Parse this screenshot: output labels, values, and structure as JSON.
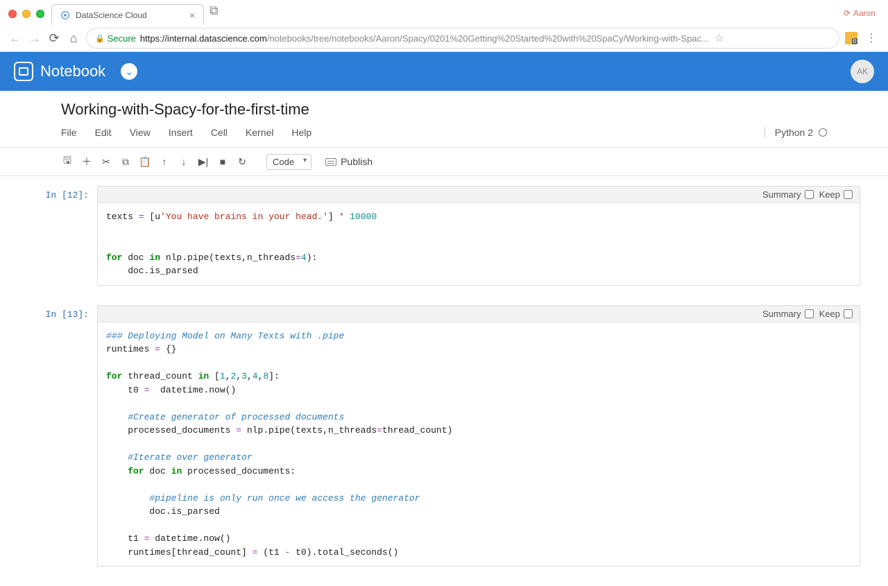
{
  "browser": {
    "tab_title": "DataScience Cloud",
    "profile": "Aaron",
    "secure_label": "Secure",
    "url_host": "https://internal.datascience.com",
    "url_path": "/notebooks/tree/notebooks/Aaron/Spacy/0201%20Getting%20Started%20with%20SpaCy/Working-with-Spac...",
    "ext_badge": "0"
  },
  "header": {
    "brand": "Notebook",
    "avatar_initials": "AK"
  },
  "notebook": {
    "title": "Working-with-Spacy-for-the-first-time",
    "menus": [
      "File",
      "Edit",
      "View",
      "Insert",
      "Cell",
      "Kernel",
      "Help"
    ],
    "kernel": "Python 2",
    "cell_type_label": "Code",
    "publish_label": "Publish",
    "cell_controls": {
      "summary": "Summary",
      "keep": "Keep"
    }
  },
  "cells": [
    {
      "prompt": "In [12]:",
      "code_tokens": [
        [
          "fn",
          "texts "
        ],
        [
          "op",
          "="
        ],
        [
          "fn",
          " ["
        ],
        [
          "fn",
          "u"
        ],
        [
          "str",
          "'You have brains in your head.'"
        ],
        [
          "fn",
          "] "
        ],
        [
          "op",
          "*"
        ],
        [
          "fn",
          " "
        ],
        [
          "num",
          "10000"
        ],
        [
          "nl",
          ""
        ],
        [
          "nl",
          ""
        ],
        [
          "nl",
          ""
        ],
        [
          "kw",
          "for"
        ],
        [
          "fn",
          " doc "
        ],
        [
          "kw",
          "in"
        ],
        [
          "fn",
          " nlp.pipe(texts,n_threads"
        ],
        [
          "op",
          "="
        ],
        [
          "num",
          "4"
        ],
        [
          "fn",
          "):"
        ],
        [
          "nl",
          ""
        ],
        [
          "fn",
          "    doc.is_parsed"
        ]
      ]
    },
    {
      "prompt": "In [13]:",
      "code_tokens": [
        [
          "cmt",
          "### Deploying Model on Many Texts with .pipe"
        ],
        [
          "nl",
          ""
        ],
        [
          "fn",
          "runtimes "
        ],
        [
          "op",
          "="
        ],
        [
          "fn",
          " {}"
        ],
        [
          "nl",
          ""
        ],
        [
          "nl",
          ""
        ],
        [
          "kw",
          "for"
        ],
        [
          "fn",
          " thread_count "
        ],
        [
          "kw",
          "in"
        ],
        [
          "fn",
          " ["
        ],
        [
          "num",
          "1"
        ],
        [
          "fn",
          ","
        ],
        [
          "num",
          "2"
        ],
        [
          "fn",
          ","
        ],
        [
          "num",
          "3"
        ],
        [
          "fn",
          ","
        ],
        [
          "num",
          "4"
        ],
        [
          "fn",
          ","
        ],
        [
          "num",
          "8"
        ],
        [
          "fn",
          "]:"
        ],
        [
          "nl",
          ""
        ],
        [
          "fn",
          "    t0 "
        ],
        [
          "op",
          "="
        ],
        [
          "fn",
          "  datetime.now()"
        ],
        [
          "nl",
          ""
        ],
        [
          "nl",
          ""
        ],
        [
          "fn",
          "    "
        ],
        [
          "cmt",
          "#Create generator of processed documents"
        ],
        [
          "nl",
          ""
        ],
        [
          "fn",
          "    processed_documents "
        ],
        [
          "op",
          "="
        ],
        [
          "fn",
          " nlp.pipe(texts,n_threads"
        ],
        [
          "op",
          "="
        ],
        [
          "fn",
          "thread_count)"
        ],
        [
          "nl",
          ""
        ],
        [
          "nl",
          ""
        ],
        [
          "fn",
          "    "
        ],
        [
          "cmt",
          "#Iterate over generator"
        ],
        [
          "nl",
          ""
        ],
        [
          "fn",
          "    "
        ],
        [
          "kw",
          "for"
        ],
        [
          "fn",
          " doc "
        ],
        [
          "kw",
          "in"
        ],
        [
          "fn",
          " processed_documents:"
        ],
        [
          "nl",
          ""
        ],
        [
          "nl",
          ""
        ],
        [
          "fn",
          "        "
        ],
        [
          "cmt",
          "#pipeline is only run once we access the generator"
        ],
        [
          "nl",
          ""
        ],
        [
          "fn",
          "        doc.is_parsed"
        ],
        [
          "nl",
          ""
        ],
        [
          "nl",
          ""
        ],
        [
          "fn",
          "    t1 "
        ],
        [
          "op",
          "="
        ],
        [
          "fn",
          " datetime.now()"
        ],
        [
          "nl",
          ""
        ],
        [
          "fn",
          "    runtimes[thread_count] "
        ],
        [
          "op",
          "="
        ],
        [
          "fn",
          " (t1 "
        ],
        [
          "op",
          "-"
        ],
        [
          "fn",
          " t0).total_seconds()"
        ]
      ]
    }
  ]
}
